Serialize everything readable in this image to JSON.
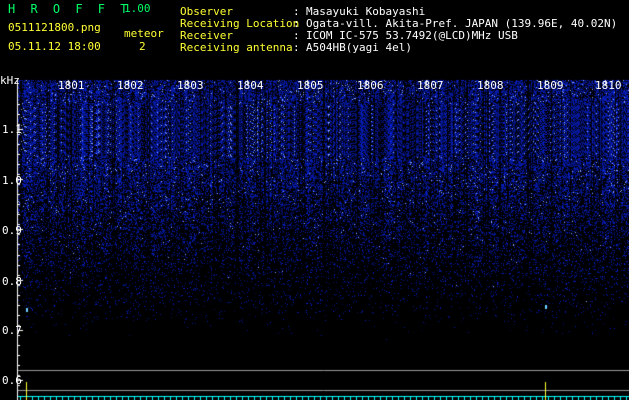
{
  "app": {
    "title": "H R O F F T",
    "version": "1.00",
    "filename": "0511121800.png",
    "datetime": "05.11.12 18:00",
    "meteor_label": "meteor",
    "meteor_count": "2"
  },
  "info": {
    "observer_label": "Observer",
    "observer_value": "Masayuki Kobayashi",
    "location_label": "Receiving Location",
    "location_value": "Ogata-vill. Akita-Pref. JAPAN (139.96E, 40.02N)",
    "receiver_label": "Receiver",
    "receiver_value": "ICOM IC-575 53.7492(@LCD)MHz USB",
    "antenna_label": "Receiving antenna",
    "antenna_value": "A504HB(yagi 4el)",
    "separator": ":"
  },
  "chart_data": {
    "type": "heatmap",
    "ylabel": "kHz",
    "y_ticks": [
      "1.1",
      "1.0",
      "0.9",
      "0.8",
      "0.7",
      "0.6"
    ],
    "x_ticks": [
      "1801",
      "1802",
      "1803",
      "1804",
      "1805",
      "1806",
      "1807",
      "1808",
      "1809",
      "1810"
    ],
    "meteor_marks": [
      {
        "x_time": "1800.3",
        "freq_khz": 0.74
      },
      {
        "x_time": "1809.0",
        "freq_khz": 0.745
      }
    ],
    "colors": {
      "background": "#000000",
      "signal": "#1e3cff",
      "signal_bright": "#8aa0ff",
      "axis": "#ffffff",
      "trace": "#ffff33",
      "baseline": "#00ffff"
    }
  }
}
